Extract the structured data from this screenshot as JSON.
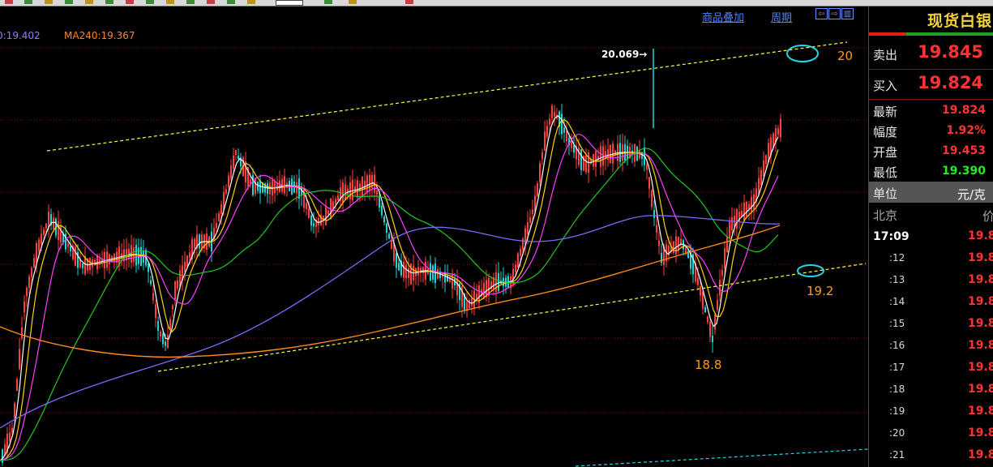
{
  "header": {
    "ma_readouts": [
      {
        "text": "0:19.402",
        "color": "#8b7fff"
      },
      {
        "text": "MA240:19.367",
        "color": "#ff8a1a"
      }
    ],
    "overlay_link": "商品叠加",
    "period_link": "周期",
    "nav_buttons": [
      "⇦",
      "⇨",
      "▥"
    ]
  },
  "chart": {
    "high_label": "20.069",
    "annotations": {
      "top_target": "20",
      "support": "19.2",
      "low": "18.8"
    },
    "colors": {
      "up": "#ff4040",
      "down": "#22d6d6",
      "ma5": "#ffffff",
      "ma10": "#ffd400",
      "ma20": "#ff3fff",
      "ma60": "#22c922",
      "ma120": "#7b6bff",
      "ma240": "#ff8a1a",
      "channel": "#ffff40",
      "circle": "#22d6e6"
    }
  },
  "panel": {
    "title": "现货白银",
    "sell": {
      "label": "卖出",
      "value": "19.845"
    },
    "buy": {
      "label": "买入",
      "value": "19.824"
    },
    "stats": [
      {
        "label": "最新",
        "value": "19.824",
        "color": "#ff3333"
      },
      {
        "label": "幅度",
        "value": "1.92%",
        "color": "#ff3333"
      },
      {
        "label": "开盘",
        "value": "19.453",
        "color": "#ff3333"
      },
      {
        "label": "最低",
        "value": "19.390",
        "color": "#22ee22"
      }
    ],
    "unit": {
      "label": "单位",
      "value": "元/克"
    },
    "city": {
      "label": "北京",
      "value": "价"
    },
    "ticks": [
      {
        "time": "17:09",
        "price": "19.8"
      },
      {
        "time": ":12",
        "price": "19.8"
      },
      {
        "time": ":13",
        "price": "19.8"
      },
      {
        "time": ":14",
        "price": "19.8"
      },
      {
        "time": ":15",
        "price": "19.8"
      },
      {
        "time": ":16",
        "price": "19.8"
      },
      {
        "time": ":17",
        "price": "19.8"
      },
      {
        "time": ":18",
        "price": "19.8"
      },
      {
        "time": ":19",
        "price": "19.8"
      },
      {
        "time": ":20",
        "price": "19.8"
      },
      {
        "time": ":21",
        "price": "19.8"
      }
    ]
  }
}
